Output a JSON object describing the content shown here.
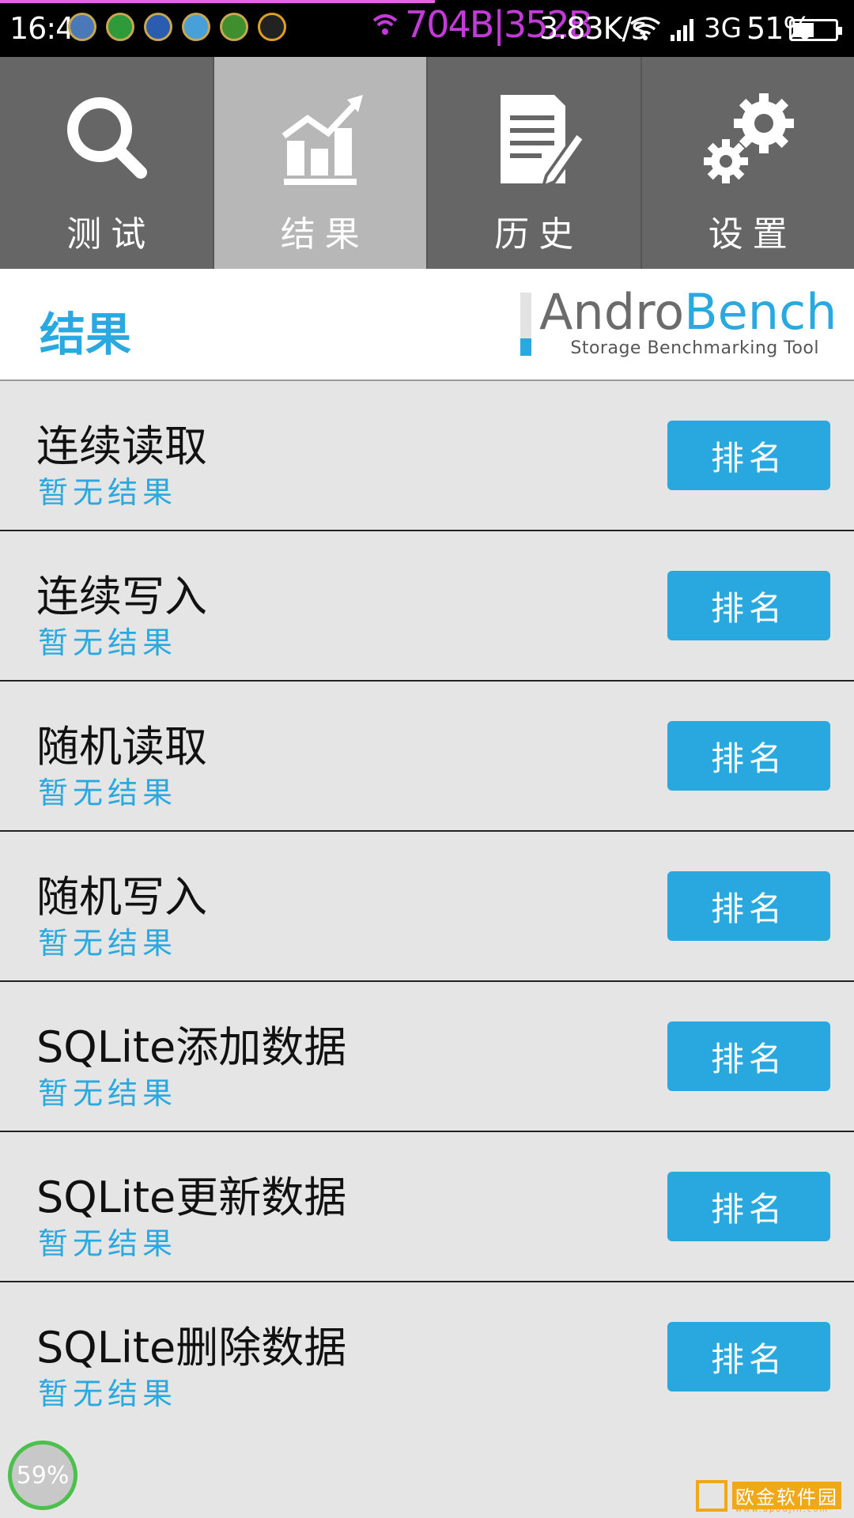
{
  "status_bar": {
    "time": "16:40",
    "traffic": "704B|352B",
    "speed": "3.83K/s",
    "network_type": "3G",
    "battery_percent": "51%",
    "battery_level": 0.51,
    "notification_icons": [
      "app-icon-1",
      "app-icon-2",
      "app-icon-3",
      "app-icon-4",
      "app-icon-5",
      "qq-icon"
    ]
  },
  "tabs": [
    {
      "label": "测试",
      "icon": "search-icon",
      "active": false
    },
    {
      "label": "结果",
      "icon": "chart-icon",
      "active": true
    },
    {
      "label": "历史",
      "icon": "document-edit-icon",
      "active": false
    },
    {
      "label": "设置",
      "icon": "gear-icon",
      "active": false
    }
  ],
  "header": {
    "title": "结果",
    "logo_part1": "Andro",
    "logo_part2": "Bench",
    "logo_subtitle": "Storage Benchmarking Tool"
  },
  "results": [
    {
      "title": "连续读取",
      "result": "暂无结果",
      "button": "排名"
    },
    {
      "title": "连续写入",
      "result": "暂无结果",
      "button": "排名"
    },
    {
      "title": "随机读取",
      "result": "暂无结果",
      "button": "排名"
    },
    {
      "title": "随机写入",
      "result": "暂无结果",
      "button": "排名"
    },
    {
      "title": "SQLite添加数据",
      "result": "暂无结果",
      "button": "排名"
    },
    {
      "title": "SQLite更新数据",
      "result": "暂无结果",
      "button": "排名"
    },
    {
      "title": "SQLite删除数据",
      "result": "暂无结果",
      "button": "排名"
    }
  ],
  "float_widget": {
    "value": "59%"
  },
  "watermark": {
    "text": "欧金软件园",
    "url": "www.apoujin.com"
  },
  "colors": {
    "accent": "#29a8df",
    "tab_bg": "#666666",
    "tab_active": "#b7b7b7",
    "list_bg": "#e5e5e5"
  }
}
